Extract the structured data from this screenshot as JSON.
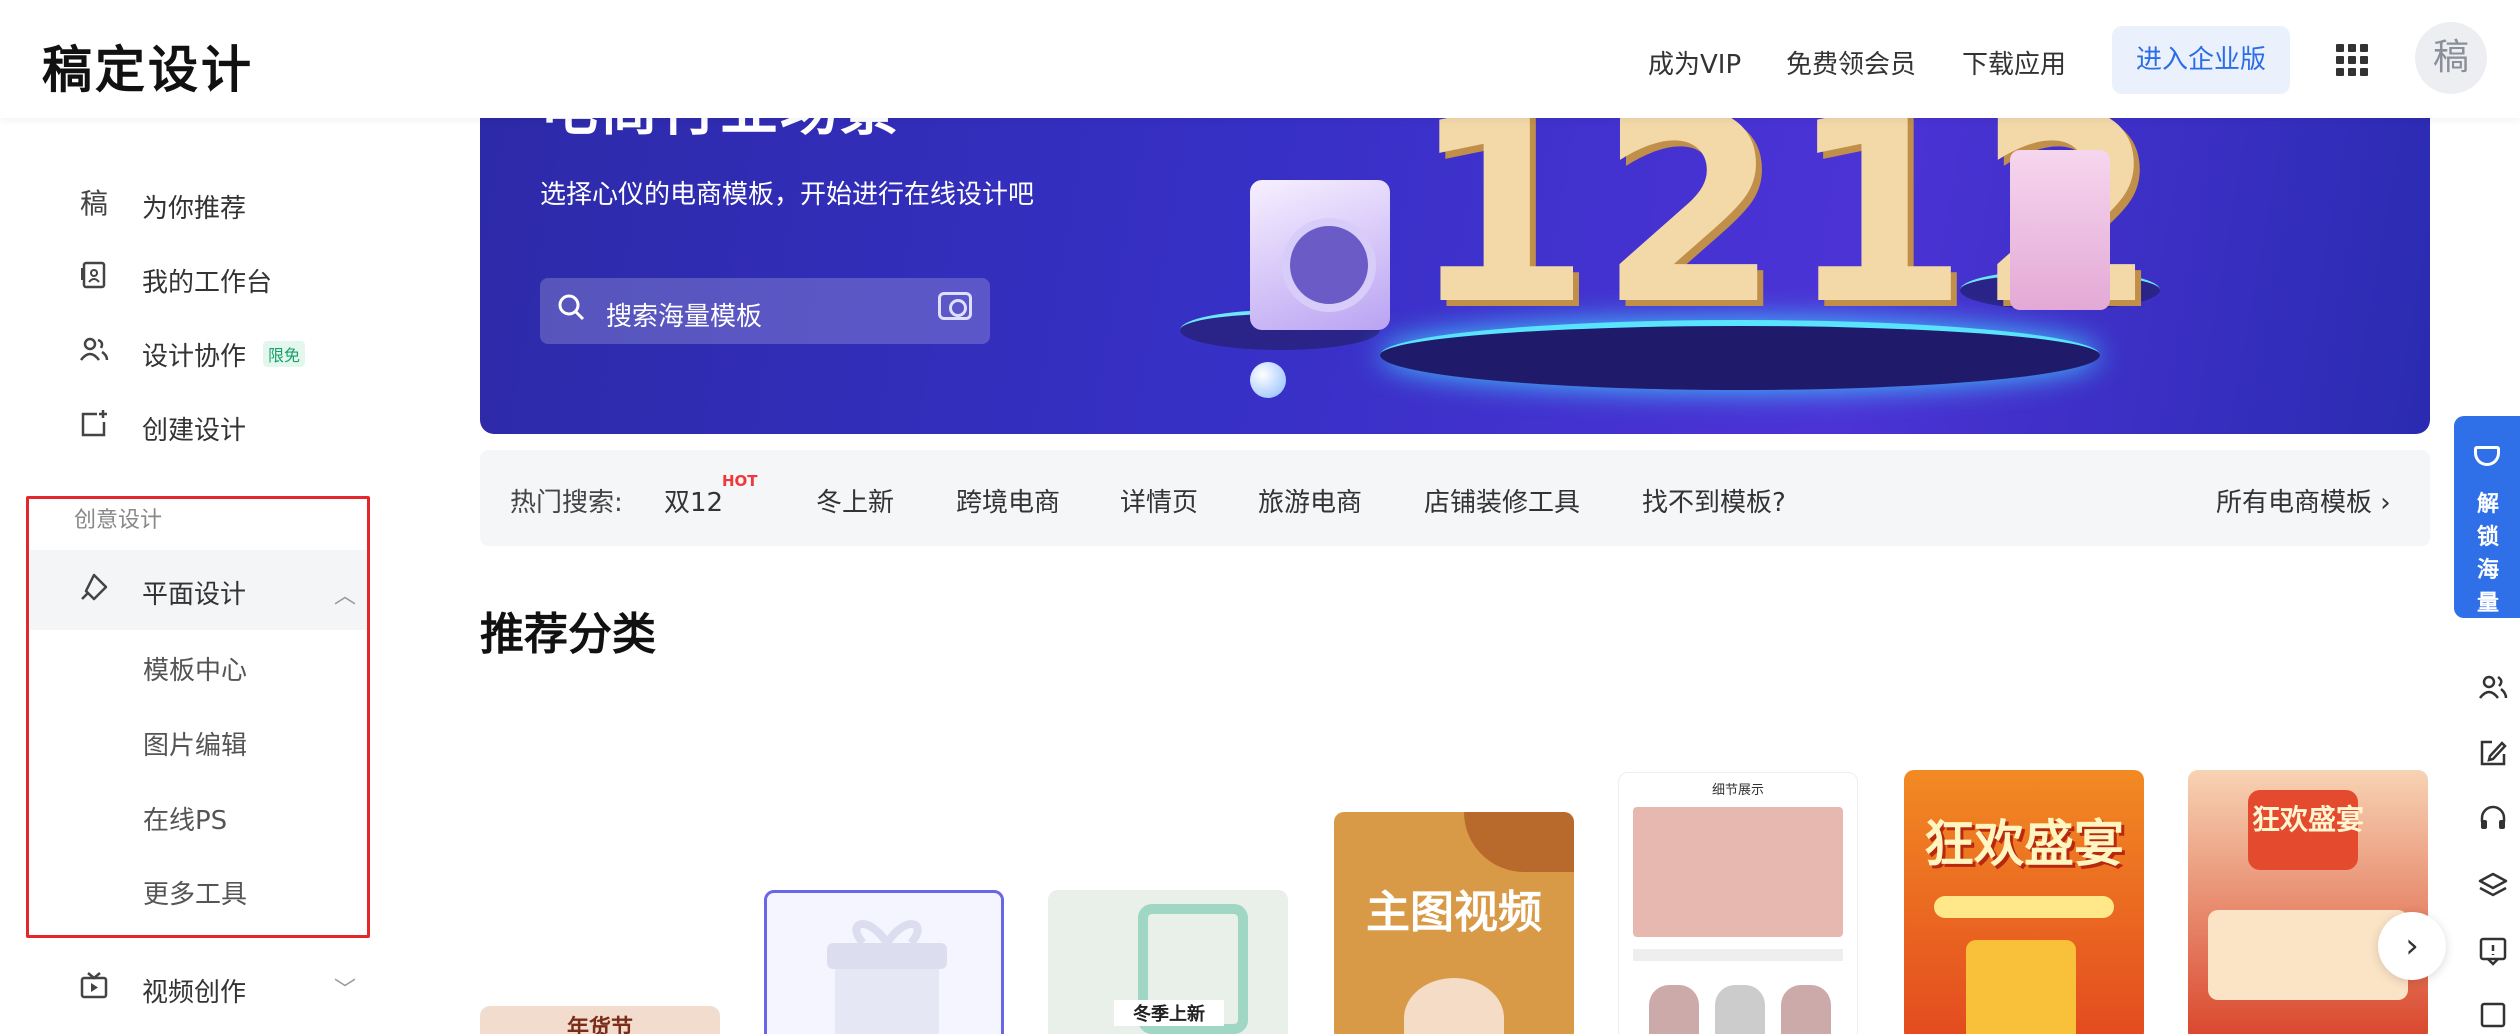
{
  "header": {
    "logo": "稿定设计",
    "links": [
      "成为VIP",
      "免费领会员",
      "下载应用"
    ],
    "enterprise_button": "进入企业版",
    "avatar_text": "稿"
  },
  "sidebar": {
    "items": [
      {
        "icon": "稿",
        "label": "为你推荐"
      },
      {
        "icon": "workbench-icon",
        "label": "我的工作台"
      },
      {
        "icon": "users-icon",
        "label": "设计协作",
        "badge": "限免"
      },
      {
        "icon": "create-icon",
        "label": "创建设计"
      }
    ],
    "section_title": "创意设计",
    "active_group": {
      "label": "平面设计",
      "icon": "pen-icon",
      "expanded": true
    },
    "sub_items": [
      "模板中心",
      "图片编辑",
      "在线PS",
      "更多工具"
    ],
    "next_group": {
      "label": "视频创作",
      "icon": "video-icon"
    },
    "highlight_color": "#e5262b"
  },
  "banner": {
    "title": "电商行业场景",
    "subtitle": "选择心仪的电商模板，开始进行在线设计吧",
    "search_placeholder": "搜索海量模板",
    "big_text": "1212"
  },
  "hot_search": {
    "label": "热门搜索:",
    "keywords": [
      "双12",
      "冬上新",
      "跨境电商",
      "详情页",
      "旅游电商",
      "店铺装修工具",
      "找不到模板?"
    ],
    "hot_tag": "HOT",
    "all_link": "所有电商模板"
  },
  "recommend": {
    "title": "推荐分类",
    "cards": [
      {
        "text": "年货节"
      },
      {
        "text": ""
      },
      {
        "text": "冬季上新"
      },
      {
        "text": "主图视频"
      },
      {
        "text": "细节展示"
      },
      {
        "text": "狂欢盛宴"
      },
      {
        "text": "狂欢盛宴"
      }
    ]
  },
  "right_rail": {
    "unlock_text": "解锁海量模板",
    "icons": [
      "team-icon",
      "edit-icon",
      "headset-icon",
      "layers-icon",
      "feedback-icon",
      "more-icon"
    ]
  },
  "colors": {
    "accent": "#2f6fe8",
    "banner_bg": "#3730c6",
    "hot": "#f0373a"
  }
}
